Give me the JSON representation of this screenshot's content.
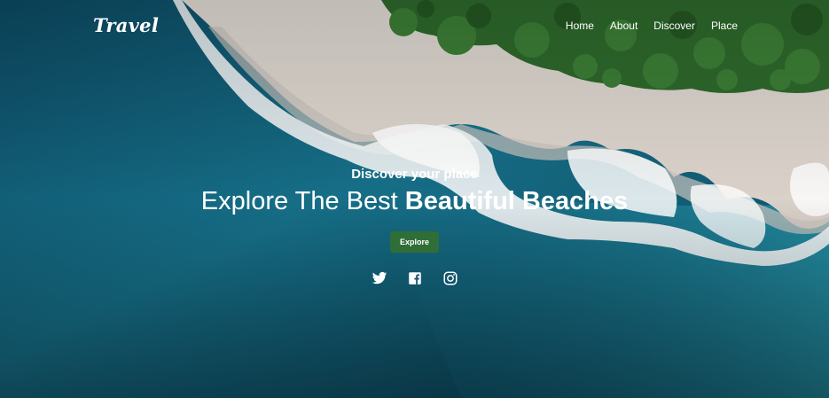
{
  "brand": {
    "logo_text": "Travel"
  },
  "nav": {
    "items": [
      {
        "label": "Home"
      },
      {
        "label": "About"
      },
      {
        "label": "Discover"
      },
      {
        "label": "Place"
      }
    ]
  },
  "hero": {
    "subtitle": "Discover your place",
    "title_regular": "Explore The Best",
    "title_bold": "Beautiful Beaches",
    "cta_label": "Explore"
  },
  "socials": [
    {
      "icon": "twitter-icon"
    },
    {
      "icon": "facebook-icon"
    },
    {
      "icon": "instagram-icon"
    }
  ],
  "colors": {
    "ocean_deep": "#0b3f55",
    "ocean_mid": "#146c84",
    "sand": "#ddd6cf",
    "foliage": "#2e6a2c",
    "button": "#2f6e37"
  }
}
